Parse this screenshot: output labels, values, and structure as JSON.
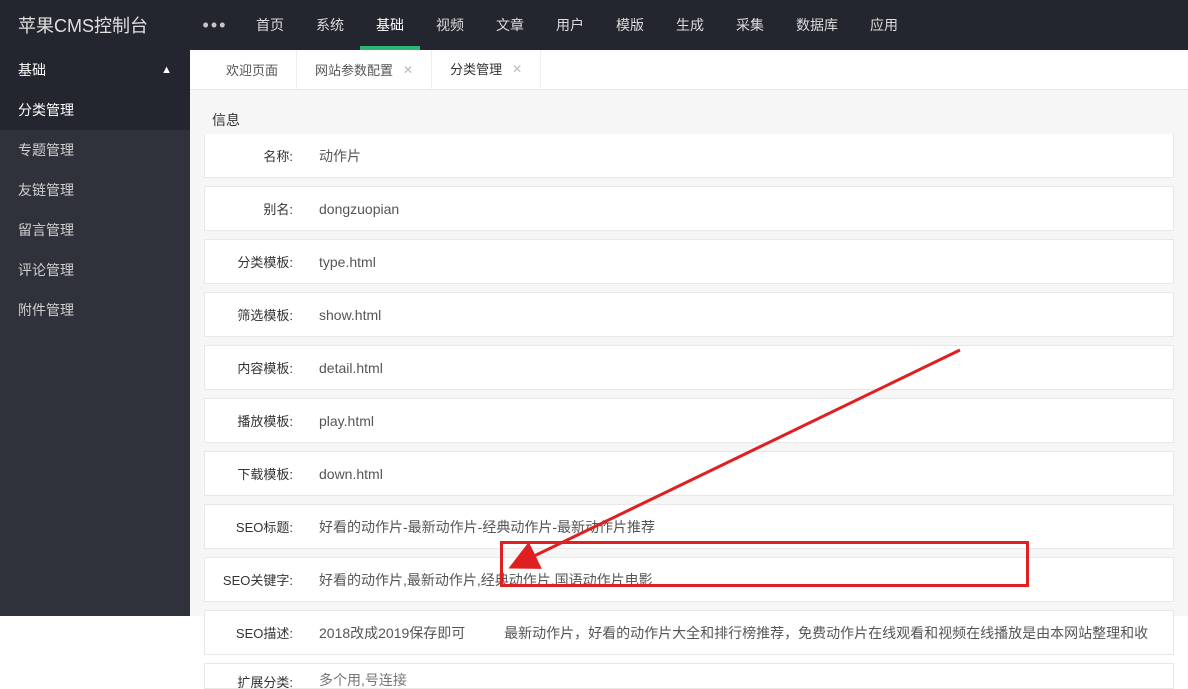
{
  "logo": "苹果CMS控制台",
  "dots": "•••",
  "nav": [
    {
      "label": "首页",
      "active": false
    },
    {
      "label": "系统",
      "active": false
    },
    {
      "label": "基础",
      "active": true
    },
    {
      "label": "视频",
      "active": false
    },
    {
      "label": "文章",
      "active": false
    },
    {
      "label": "用户",
      "active": false
    },
    {
      "label": "模版",
      "active": false
    },
    {
      "label": "生成",
      "active": false
    },
    {
      "label": "采集",
      "active": false
    },
    {
      "label": "数据库",
      "active": false
    },
    {
      "label": "应用",
      "active": false
    }
  ],
  "side_head": "基础",
  "side_items": [
    {
      "label": "分类管理",
      "active": true
    },
    {
      "label": "专题管理",
      "active": false
    },
    {
      "label": "友链管理",
      "active": false
    },
    {
      "label": "留言管理",
      "active": false
    },
    {
      "label": "评论管理",
      "active": false
    },
    {
      "label": "附件管理",
      "active": false
    }
  ],
  "tabs": [
    {
      "label": "欢迎页面",
      "closable": false,
      "active": false
    },
    {
      "label": "网站参数配置",
      "closable": true,
      "active": false
    },
    {
      "label": "分类管理",
      "closable": true,
      "active": true
    }
  ],
  "panel_title": "信息",
  "rows": [
    {
      "label": "名称:",
      "value": "动作片",
      "tight": true
    },
    {
      "label": "别名:",
      "value": "dongzuopian"
    },
    {
      "label": "分类模板:",
      "value": "type.html"
    },
    {
      "label": "筛选模板:",
      "value": "show.html"
    },
    {
      "label": "内容模板:",
      "value": "detail.html"
    },
    {
      "label": "播放模板:",
      "value": "play.html"
    },
    {
      "label": "下载模板:",
      "value": "down.html"
    },
    {
      "label": "SEO标题:",
      "value": "好看的动作片-最新动作片-经典动作片-最新动作片推荐"
    },
    {
      "label": "SEO关键字:",
      "value": "好看的动作片,最新动作片,经典动作片,国语动作片电影"
    },
    {
      "label": "SEO描述:",
      "value": "2018改成2019保存即可          最新动作片，好看的动作片大全和排行榜推荐，免费动作片在线观看和视频在线播放是由本网站整理和收"
    },
    {
      "label": "扩展分类:",
      "value": "",
      "placeholder": "多个用,号连接",
      "partial": true
    }
  ]
}
